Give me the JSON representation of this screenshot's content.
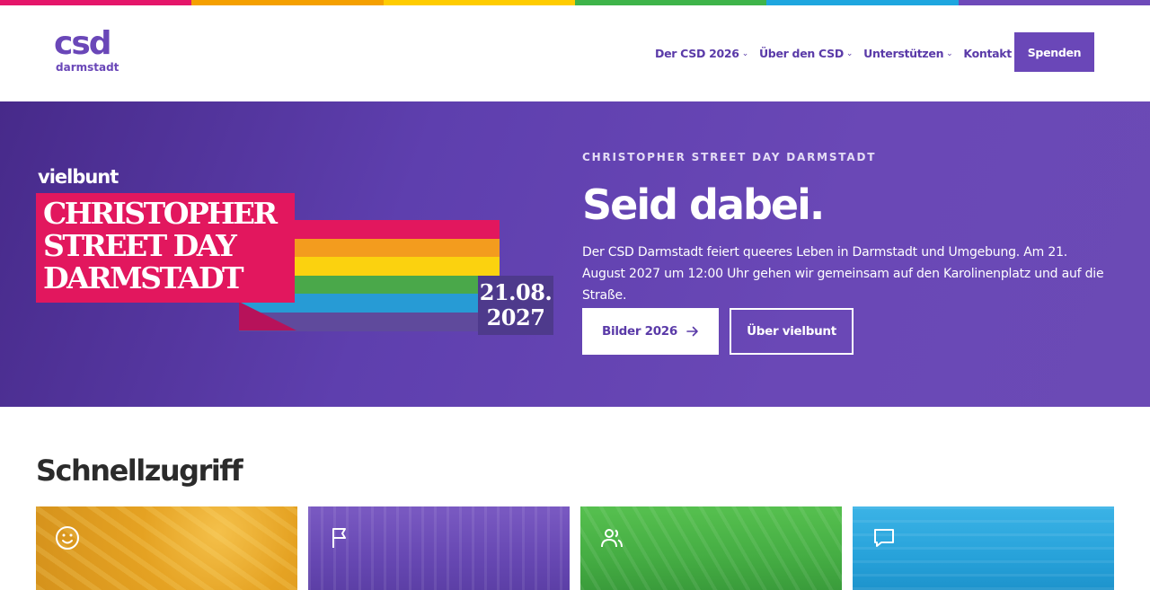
{
  "rainbow_colors": [
    "#e5166a",
    "#f5a000",
    "#ffcc00",
    "#3fb44a",
    "#1ea6df",
    "#6e4ab9"
  ],
  "logo": {
    "mark": "csd",
    "town": "darmstadt"
  },
  "nav": {
    "items": [
      {
        "label": "Der CSD 2026",
        "icon": "chevron-down-icon"
      },
      {
        "label": "Über den CSD",
        "icon": "chevron-down-icon"
      },
      {
        "label": "Unterstützen",
        "icon": "chevron-down-icon"
      },
      {
        "label": "Kontakt",
        "icon": "chevron-down-icon"
      }
    ],
    "donate_label": "Spenden"
  },
  "hero": {
    "poster": {
      "brand": "vielbunt",
      "title_lines": [
        "CHRISTOPHER",
        "STREET DAY",
        "DARMSTADT"
      ],
      "date_lines": [
        "21.08.",
        "2027"
      ],
      "flag_colors": [
        "#e2175e",
        "#f39c1e",
        "#fbd20f",
        "#4aa84a",
        "#279bd5",
        "#5f4a9c"
      ]
    },
    "eyebrow": "CHRISTOPHER STREET DAY DARMSTADT",
    "title": "Seid dabei.",
    "description": "Der CSD Darmstadt feiert queeres Leben in Darmstadt und Umgebung. Am 21. August 2027 um 12:00 Uhr gehen wir gemeinsam auf den Karolinenplatz und auf die Straße.",
    "primary_button": {
      "label": "Bilder 2026",
      "icon": "arrow-right-icon"
    },
    "secondary_button": {
      "label": "Über vielbunt"
    }
  },
  "quick_access": {
    "title": "Schnellzugriff",
    "cards": [
      {
        "icon": "smiley-icon",
        "color": "#e8a21a"
      },
      {
        "icon": "flag-icon",
        "color": "#6b4ab6"
      },
      {
        "icon": "people-icon",
        "color": "#49b649"
      },
      {
        "icon": "chat-bubble-icon",
        "color": "#26a3db"
      }
    ]
  }
}
